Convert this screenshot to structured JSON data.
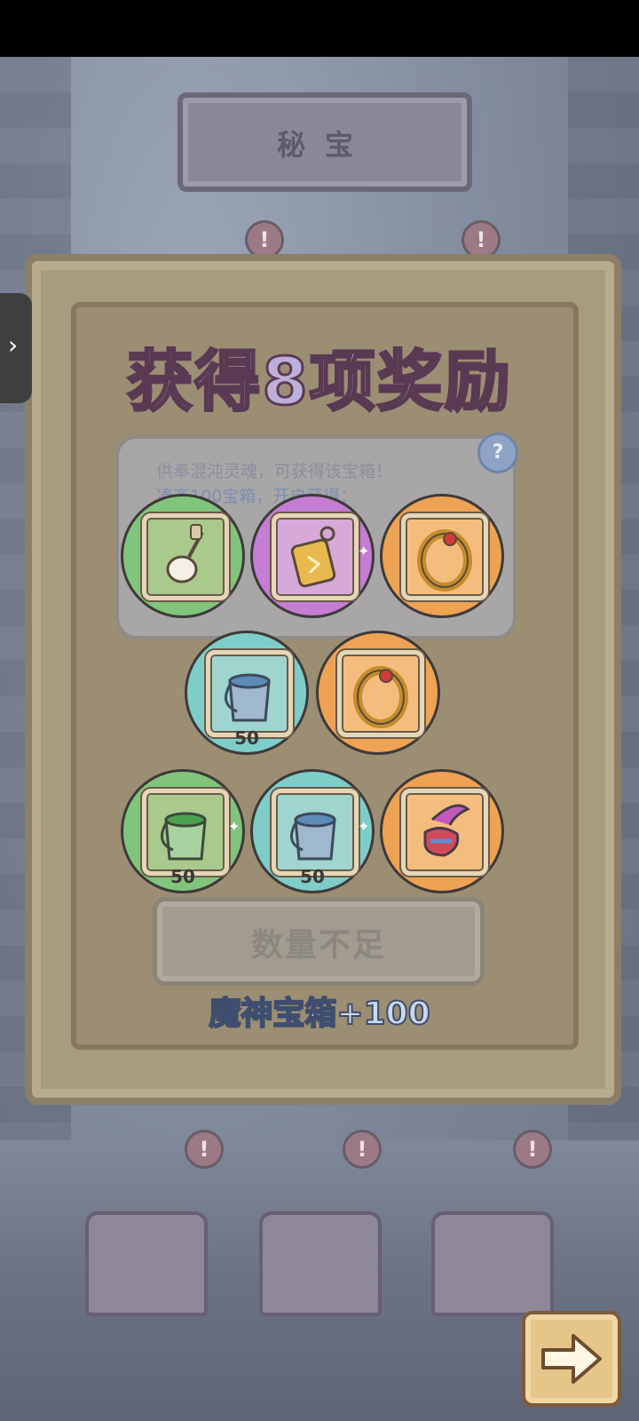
{
  "scene": {
    "header_title": "秘宝",
    "info_line1": "供奉混沌灵魂，可获得该宝箱！",
    "info_line2": "凑齐100宝箱，开启获得："
  },
  "popup": {
    "title": "获得8项奖励",
    "rewards": [
      {
        "rarity": "green",
        "icon": "pearl-pendant-icon",
        "amount": ""
      },
      {
        "rarity": "purple",
        "icon": "gold-amulet-icon",
        "amount": ""
      },
      {
        "rarity": "orange",
        "icon": "ruby-ring-icon",
        "amount": ""
      },
      {
        "rarity": "teal",
        "icon": "paint-bucket-icon",
        "amount": "50"
      },
      {
        "rarity": "orange",
        "icon": "ruby-ring-icon",
        "amount": ""
      },
      {
        "rarity": "green",
        "icon": "paint-bucket-icon",
        "amount": "50"
      },
      {
        "rarity": "teal",
        "icon": "paint-bucket-icon",
        "amount": "50"
      },
      {
        "rarity": "orange",
        "icon": "winged-boots-icon",
        "amount": ""
      }
    ],
    "insufficient_button": "数量不足",
    "chest_count": "魔神宝箱+100"
  },
  "controls": {
    "side_tab_icon": "chevron-right-icon",
    "next_icon": "arrow-right-icon"
  },
  "colors": {
    "green": "#81c57d",
    "purple": "#c47dd2",
    "orange": "#eea254",
    "teal": "#7fcdc9"
  }
}
